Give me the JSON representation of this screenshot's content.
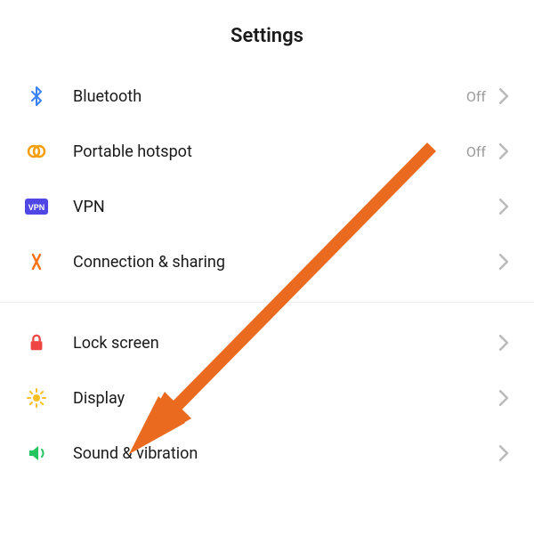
{
  "header": {
    "title": "Settings"
  },
  "sections": [
    {
      "items": [
        {
          "icon": "bluetooth-icon",
          "label": "Bluetooth",
          "status": "Off"
        },
        {
          "icon": "hotspot-icon",
          "label": "Portable hotspot",
          "status": "Off"
        },
        {
          "icon": "vpn-icon",
          "label": "VPN",
          "status": ""
        },
        {
          "icon": "connection-icon",
          "label": "Connection & sharing",
          "status": ""
        }
      ]
    },
    {
      "items": [
        {
          "icon": "lock-icon",
          "label": "Lock screen",
          "status": ""
        },
        {
          "icon": "display-icon",
          "label": "Display",
          "status": ""
        },
        {
          "icon": "sound-icon",
          "label": "Sound & vibration",
          "status": ""
        }
      ]
    }
  ],
  "annotation": {
    "type": "arrow",
    "target": "display-item"
  }
}
